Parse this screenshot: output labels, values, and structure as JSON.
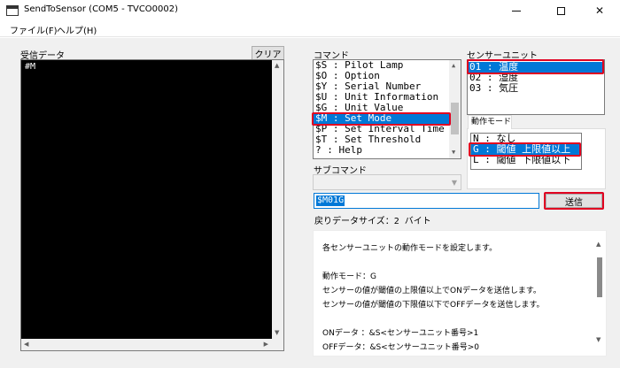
{
  "window": {
    "title": "SendToSensor (COM5 - TVCO0002)"
  },
  "menu": {
    "file": "ファイル(F)",
    "help": "ヘルプ(H)"
  },
  "receive": {
    "label": "受信データ",
    "content": "#M",
    "clear_label": "クリア"
  },
  "command": {
    "label": "コマンド",
    "items": [
      "$S : Pilot Lamp",
      "$O : Option",
      "$Y : Serial Number",
      "$U : Unit Information",
      "$G : Unit Value",
      "$M : Set Mode",
      "$P : Set Interval Time",
      "$T : Set Threshold",
      "?  : Help"
    ],
    "selected": "$M : Set Mode"
  },
  "sensor_unit": {
    "label": "センサーユニット",
    "items": [
      "01 : 温度",
      "02 : 湿度",
      "03 : 気圧"
    ],
    "selected": "01 : 温度"
  },
  "operation_mode": {
    "tab_label": "動作モード",
    "items": [
      "N : なし",
      "G : 閾値 上限値以上",
      "L : 閾値 下限値以下"
    ],
    "selected": "G : 閾値 上限値以上"
  },
  "sub_command": {
    "label": "サブコマンド",
    "value": ""
  },
  "send": {
    "input_value": "$M01G",
    "button_label": "送信"
  },
  "return_data": {
    "text": "戻りデータサイズ：2 バイト"
  },
  "description": {
    "lines": [
      "各センサーユニットの動作モードを設定します。",
      "動作モード：G",
      "センサーの値が閾値の上限値以上でONデータを送信します。",
      "センサーの値が閾値の下限値以下でOFFデータを送信します。",
      "ONデータ ：&S<センサーユニット番号>1",
      "OFFデータ：&S<センサーユニット番号>0"
    ]
  },
  "colors": {
    "selection": "#0078d7",
    "highlight_box": "#e00020",
    "console_bg": "#000000"
  }
}
